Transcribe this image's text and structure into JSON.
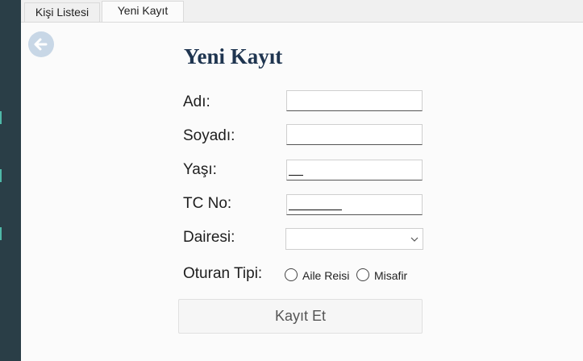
{
  "tabs": [
    {
      "label": "Kişi Listesi",
      "active": false
    },
    {
      "label": "Yeni Kayıt",
      "active": true
    }
  ],
  "back_icon": "arrow-left-circle-icon",
  "form": {
    "title": "Yeni Kayıt",
    "fields": {
      "first_name": {
        "label": "Adı:",
        "value": ""
      },
      "last_name": {
        "label": "Soyadı:",
        "value": ""
      },
      "age": {
        "label": "Yaşı:",
        "value": ""
      },
      "tc_no": {
        "label": "TC No:",
        "value": ""
      }
    },
    "apartment": {
      "label": "Dairesi:",
      "selected": ""
    },
    "resident_type": {
      "label": "Oturan Tipi:",
      "options": [
        "Aile Reisi",
        "Misafir"
      ],
      "selected": null
    },
    "submit_label": "Kayıt Et"
  },
  "colors": {
    "sidebar": "#2a3e47",
    "title": "#1f3550",
    "back_button": "#c8d7e6",
    "accent_mark": "#4fb8a8"
  }
}
